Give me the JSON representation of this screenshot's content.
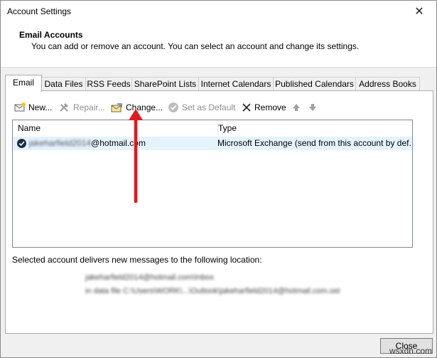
{
  "window": {
    "title": "Account Settings"
  },
  "header": {
    "title": "Email Accounts",
    "description": "You can add or remove an account. You can select an account and change its settings."
  },
  "tabs": [
    "Email",
    "Data Files",
    "RSS Feeds",
    "SharePoint Lists",
    "Internet Calendars",
    "Published Calendars",
    "Address Books"
  ],
  "toolbar": {
    "new": "New...",
    "repair": "Repair...",
    "change": "Change...",
    "set_default": "Set as Default",
    "remove": "Remove"
  },
  "accounts": {
    "columns": [
      "Name",
      "Type"
    ],
    "rows": [
      {
        "name_blurred": "jakeharfield2014",
        "name_visible": "@hotmail.com",
        "type": "Microsoft Exchange (send from this account by def..."
      }
    ]
  },
  "delivery": {
    "label": "Selected account delivers new messages to the following location:",
    "line1_blurred": "jakeharfield2014@hotmail.com\\Inbox",
    "line2_blurred": "in data file C:\\Users\\WORK\\...\\Outlook\\jakeharfield2014@hotmail.com.ost"
  },
  "buttons": {
    "close": "Close"
  },
  "watermark": "wsxdn.com",
  "colors": {
    "annotation_arrow": "#e0191e",
    "selection": "#e5f3ff"
  }
}
